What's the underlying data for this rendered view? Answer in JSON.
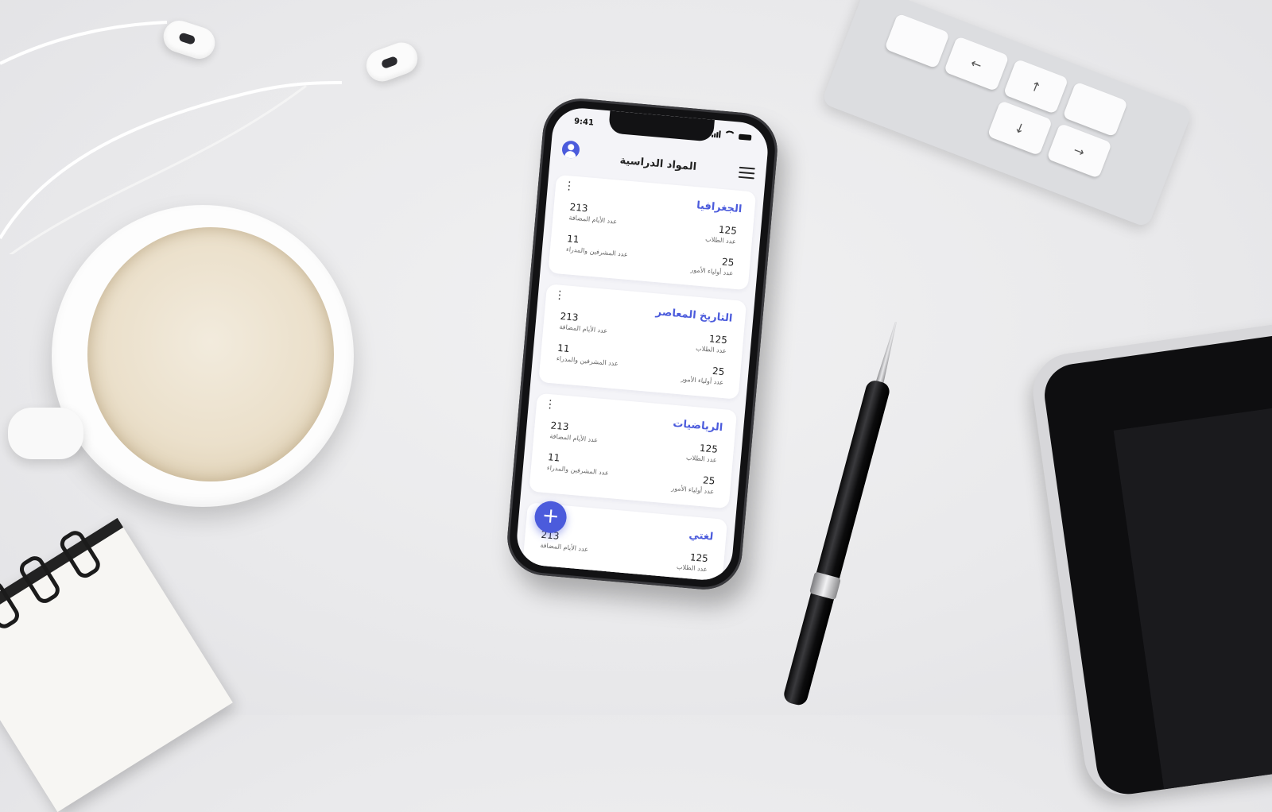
{
  "status_bar": {
    "time": "9:41"
  },
  "header": {
    "title": "المواد الدراسية"
  },
  "labels": {
    "days": "عدد الأيام المضافة",
    "supervisors": "عدد المشرفين والمدراء",
    "students": "عدد الطلاب",
    "parents": "عدد أولياء الأمور"
  },
  "subjects": [
    {
      "name": "الجغرافيا",
      "days": "213",
      "supervisors": "11",
      "students": "125",
      "parents": "25"
    },
    {
      "name": "التاريخ المعاصر",
      "days": "213",
      "supervisors": "11",
      "students": "125",
      "parents": "25"
    },
    {
      "name": "الرياضيات",
      "days": "213",
      "supervisors": "11",
      "students": "125",
      "parents": "25"
    },
    {
      "name": "لغتي",
      "days": "213",
      "students": "125"
    }
  ],
  "fab": {
    "label": "+"
  },
  "keyboard_keys": [
    "←",
    "↑",
    "↓",
    "→"
  ],
  "colors": {
    "accent": "#4b5bdc",
    "screen_bg": "#f4f4f8"
  }
}
